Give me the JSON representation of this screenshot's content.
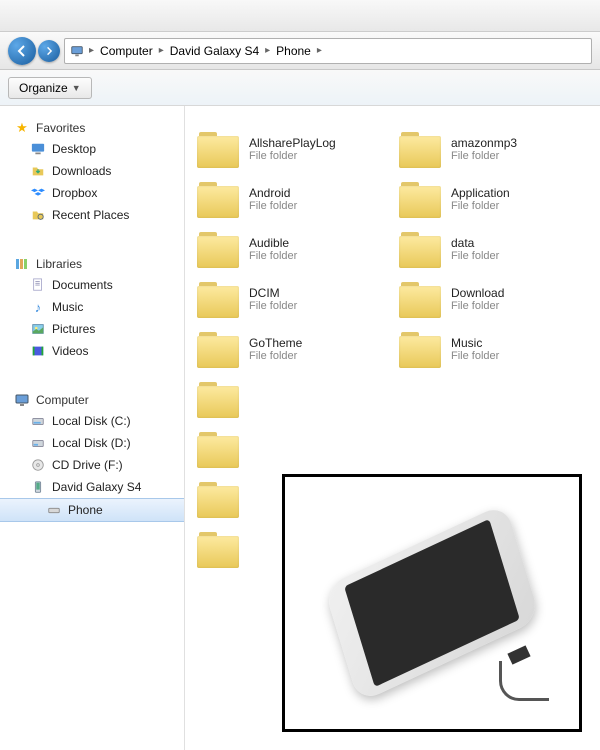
{
  "titlebar": {
    "text": ""
  },
  "breadcrumb": {
    "segments": [
      "Computer",
      "David Galaxy S4",
      "Phone"
    ]
  },
  "toolbar": {
    "organize_label": "Organize"
  },
  "sidebar": {
    "favorites": {
      "header": "Favorites",
      "items": [
        {
          "label": "Desktop",
          "icon": "desktop-icon"
        },
        {
          "label": "Downloads",
          "icon": "downloads-icon"
        },
        {
          "label": "Dropbox",
          "icon": "dropbox-icon"
        },
        {
          "label": "Recent Places",
          "icon": "recent-icon"
        }
      ]
    },
    "libraries": {
      "header": "Libraries",
      "items": [
        {
          "label": "Documents",
          "icon": "documents-icon"
        },
        {
          "label": "Music",
          "icon": "music-icon"
        },
        {
          "label": "Pictures",
          "icon": "pictures-icon"
        },
        {
          "label": "Videos",
          "icon": "videos-icon"
        }
      ]
    },
    "computer": {
      "header": "Computer",
      "items": [
        {
          "label": "Local Disk (C:)",
          "icon": "disk-icon"
        },
        {
          "label": "Local Disk (D:)",
          "icon": "disk-icon"
        },
        {
          "label": "CD Drive (F:)",
          "icon": "cd-icon"
        },
        {
          "label": "David Galaxy S4",
          "icon": "device-icon"
        },
        {
          "label": "Phone",
          "icon": "phone-storage-icon",
          "selected": true
        }
      ]
    }
  },
  "content": {
    "folder_type_label": "File folder",
    "folders_col1": [
      "AllsharePlayLog",
      "Android",
      "Audible",
      "DCIM",
      "GoTheme"
    ],
    "folders_col2": [
      "amazonmp3",
      "Application",
      "data",
      "Download",
      "Music"
    ]
  }
}
